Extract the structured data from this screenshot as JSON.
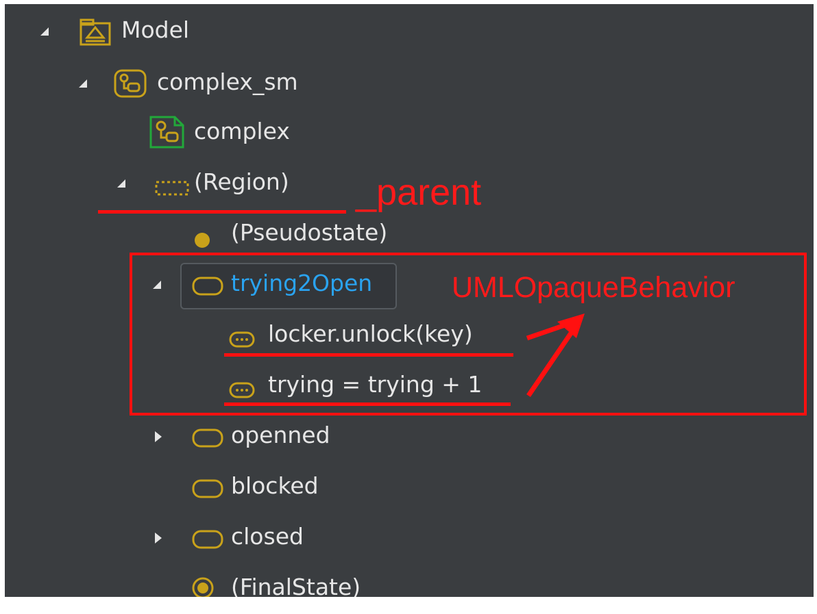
{
  "tree": {
    "model": {
      "label": "Model"
    },
    "complex_sm": {
      "label": "complex_sm"
    },
    "complex": {
      "label": "complex"
    },
    "region": {
      "label": "(Region)"
    },
    "pseudostate": {
      "label": "(Pseudostate)"
    },
    "trying2open": {
      "label": "trying2Open"
    },
    "behavior1": {
      "label": "locker.unlock(key)"
    },
    "behavior2": {
      "label": "trying = trying + 1"
    },
    "openned": {
      "label": "openned"
    },
    "blocked": {
      "label": "blocked"
    },
    "closed": {
      "label": "closed"
    },
    "finalstate": {
      "label": "(FinalState)"
    }
  },
  "annotations": {
    "parent_label": "_parent",
    "behavior_label": "UMLOpaqueBehavior"
  },
  "colors": {
    "panel_bg": "#3a3d40",
    "text": "#e6e6e6",
    "selected_text": "#2aa3f0",
    "icon_gold": "#c9a21a",
    "icon_green": "#22a83a",
    "annotation_red": "#ff1010"
  }
}
